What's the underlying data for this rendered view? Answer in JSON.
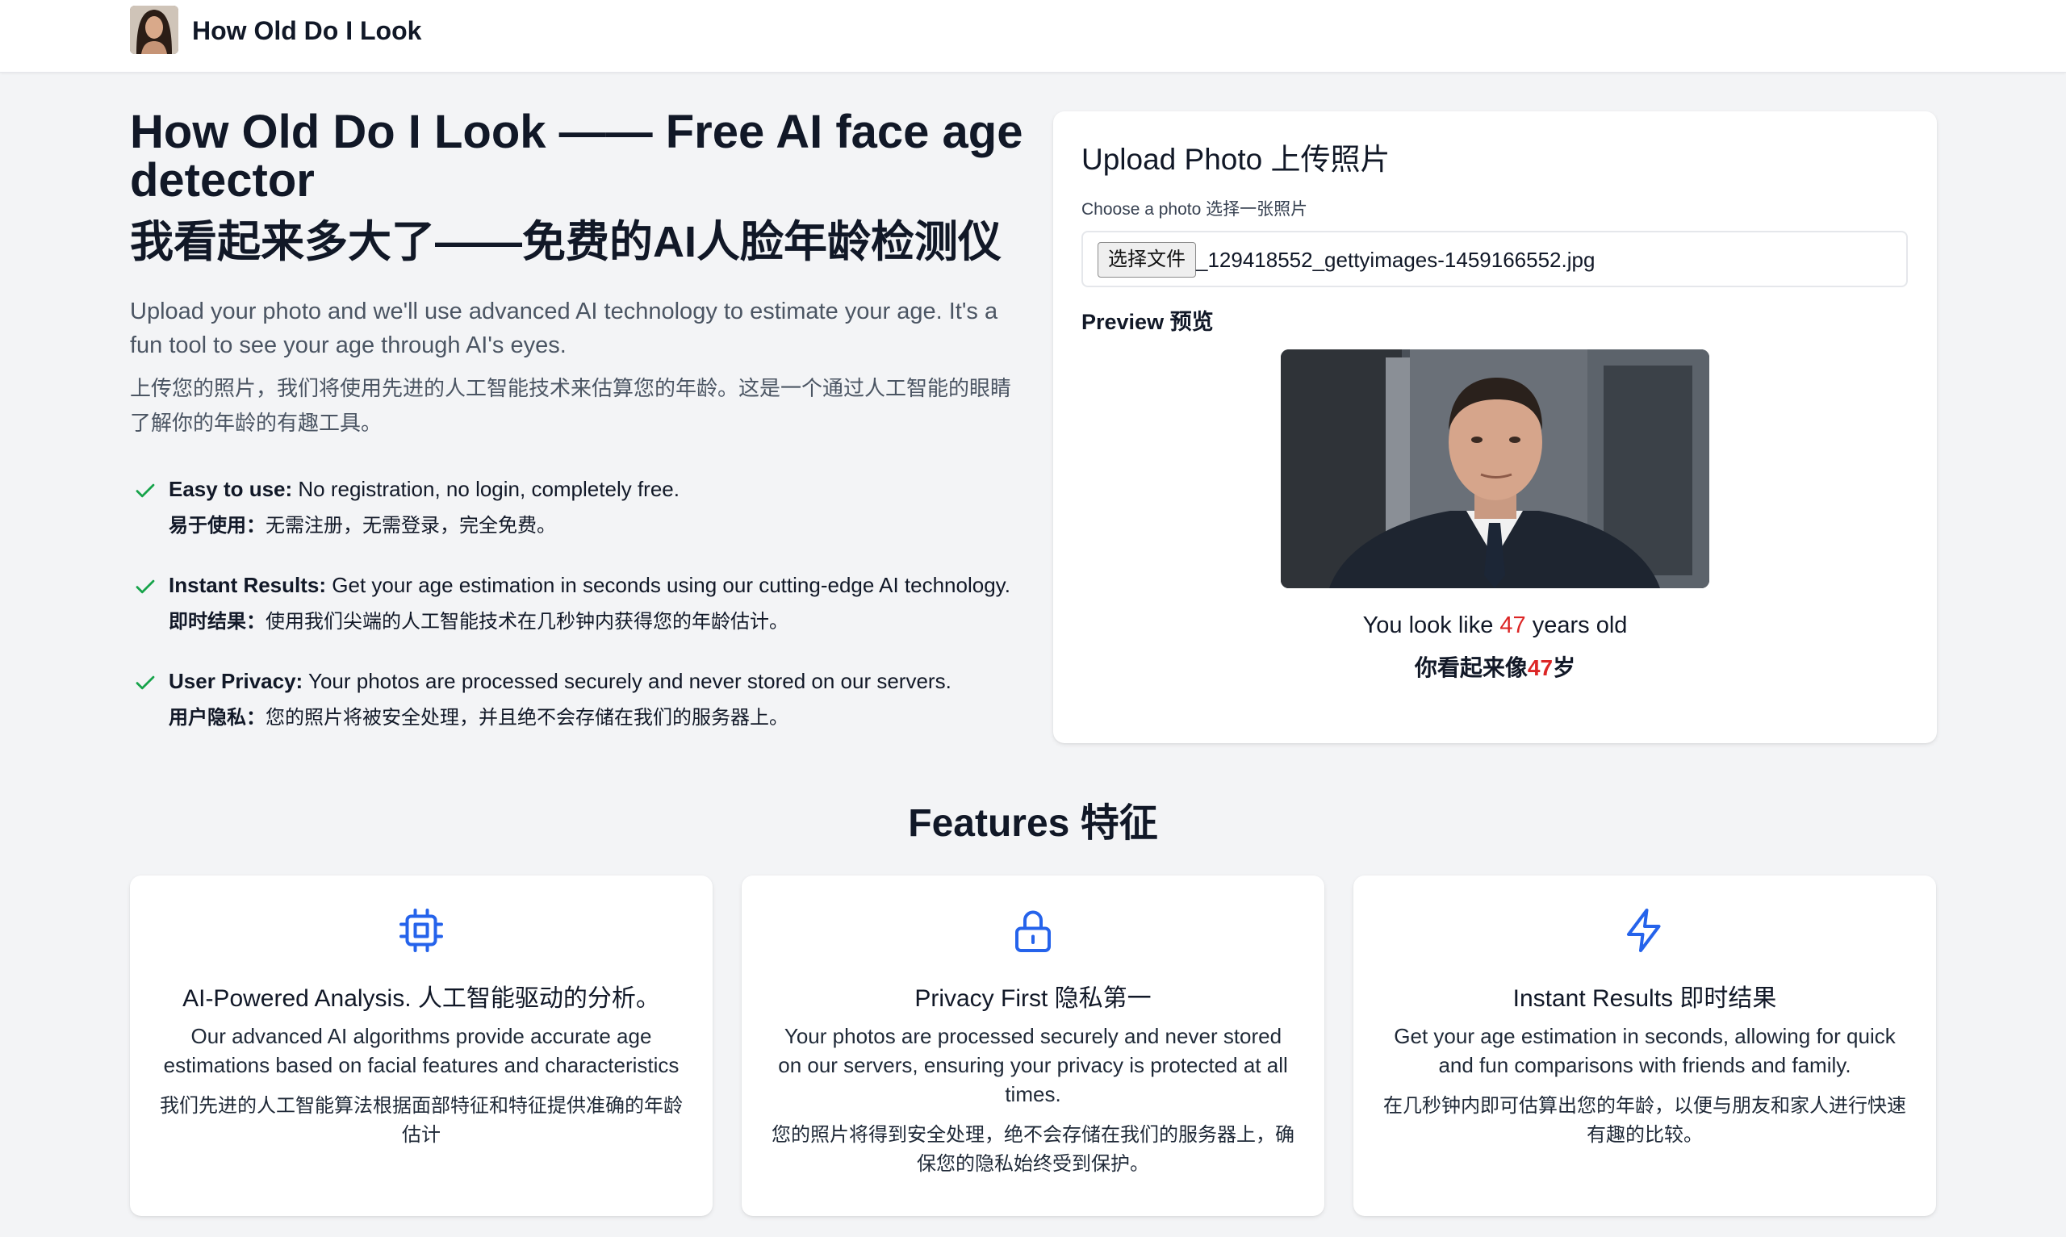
{
  "header": {
    "brand": "How Old Do I Look"
  },
  "hero": {
    "title": "How Old Do I Look —— Free AI face age detector",
    "title_zh": "我看起来多大了——免费的AI人脸年龄检测仪",
    "description": "Upload your photo and we'll use advanced AI technology to estimate your age. It's a fun tool to see your age through AI's eyes.",
    "description_zh": "上传您的照片，我们将使用先进的人工智能技术来估算您的年龄。这是一个通过人工智能的眼睛了解你的年龄的有趣工具。",
    "points": [
      {
        "label": "Easy to use:",
        "text": " No registration, no login, completely free.",
        "label_zh": "易于使用：",
        "text_zh": "无需注册，无需登录，完全免费。"
      },
      {
        "label": "Instant Results:",
        "text": " Get your age estimation in seconds using our cutting-edge AI technology.",
        "label_zh": "即时结果：",
        "text_zh": "使用我们尖端的人工智能技术在几秒钟内获得您的年龄估计。"
      },
      {
        "label": "User Privacy:",
        "text": " Your photos are processed securely and never stored on our servers.",
        "label_zh": "用户隐私：",
        "text_zh": "您的照片将被安全处理，并且绝不会存储在我们的服务器上。"
      }
    ]
  },
  "upload": {
    "title": "Upload Photo 上传照片",
    "choose_label": "Choose a photo  选择一张照片",
    "file_button": "选择文件",
    "file_name": "_129418552_gettyimages-1459166552.jpg",
    "preview_label": "Preview 预览",
    "result_prefix": "You look like ",
    "age": "47",
    "result_suffix": " years old",
    "result_zh_prefix": "你看起来像",
    "result_zh_suffix": "岁"
  },
  "features": {
    "title": "Features 特征",
    "items": [
      {
        "icon": "cpu-icon",
        "title": "AI-Powered Analysis. 人工智能驱动的分析。",
        "desc": "Our advanced AI algorithms provide accurate age estimations based on facial features and characteristics",
        "desc_zh": "我们先进的人工智能算法根据面部特征和特征提供准确的年龄估计"
      },
      {
        "icon": "lock-icon",
        "title": "Privacy First 隐私第一",
        "desc": "Your photos are processed securely and never stored on our servers, ensuring your privacy is protected at all times.",
        "desc_zh": "您的照片将得到安全处理，绝不会存储在我们的服务器上，确保您的隐私始终受到保护。"
      },
      {
        "icon": "lightning-icon",
        "title": "Instant Results 即时结果",
        "desc": "Get your age estimation in seconds, allowing for quick and fun comparisons with friends and family.",
        "desc_zh": "在几秒钟内即可估算出您的年龄，以便与朋友和家人进行快速有趣的比较。"
      }
    ]
  },
  "colors": {
    "accent_blue": "#2563eb",
    "check_green": "#16a34a",
    "age_red": "#dc2626"
  }
}
